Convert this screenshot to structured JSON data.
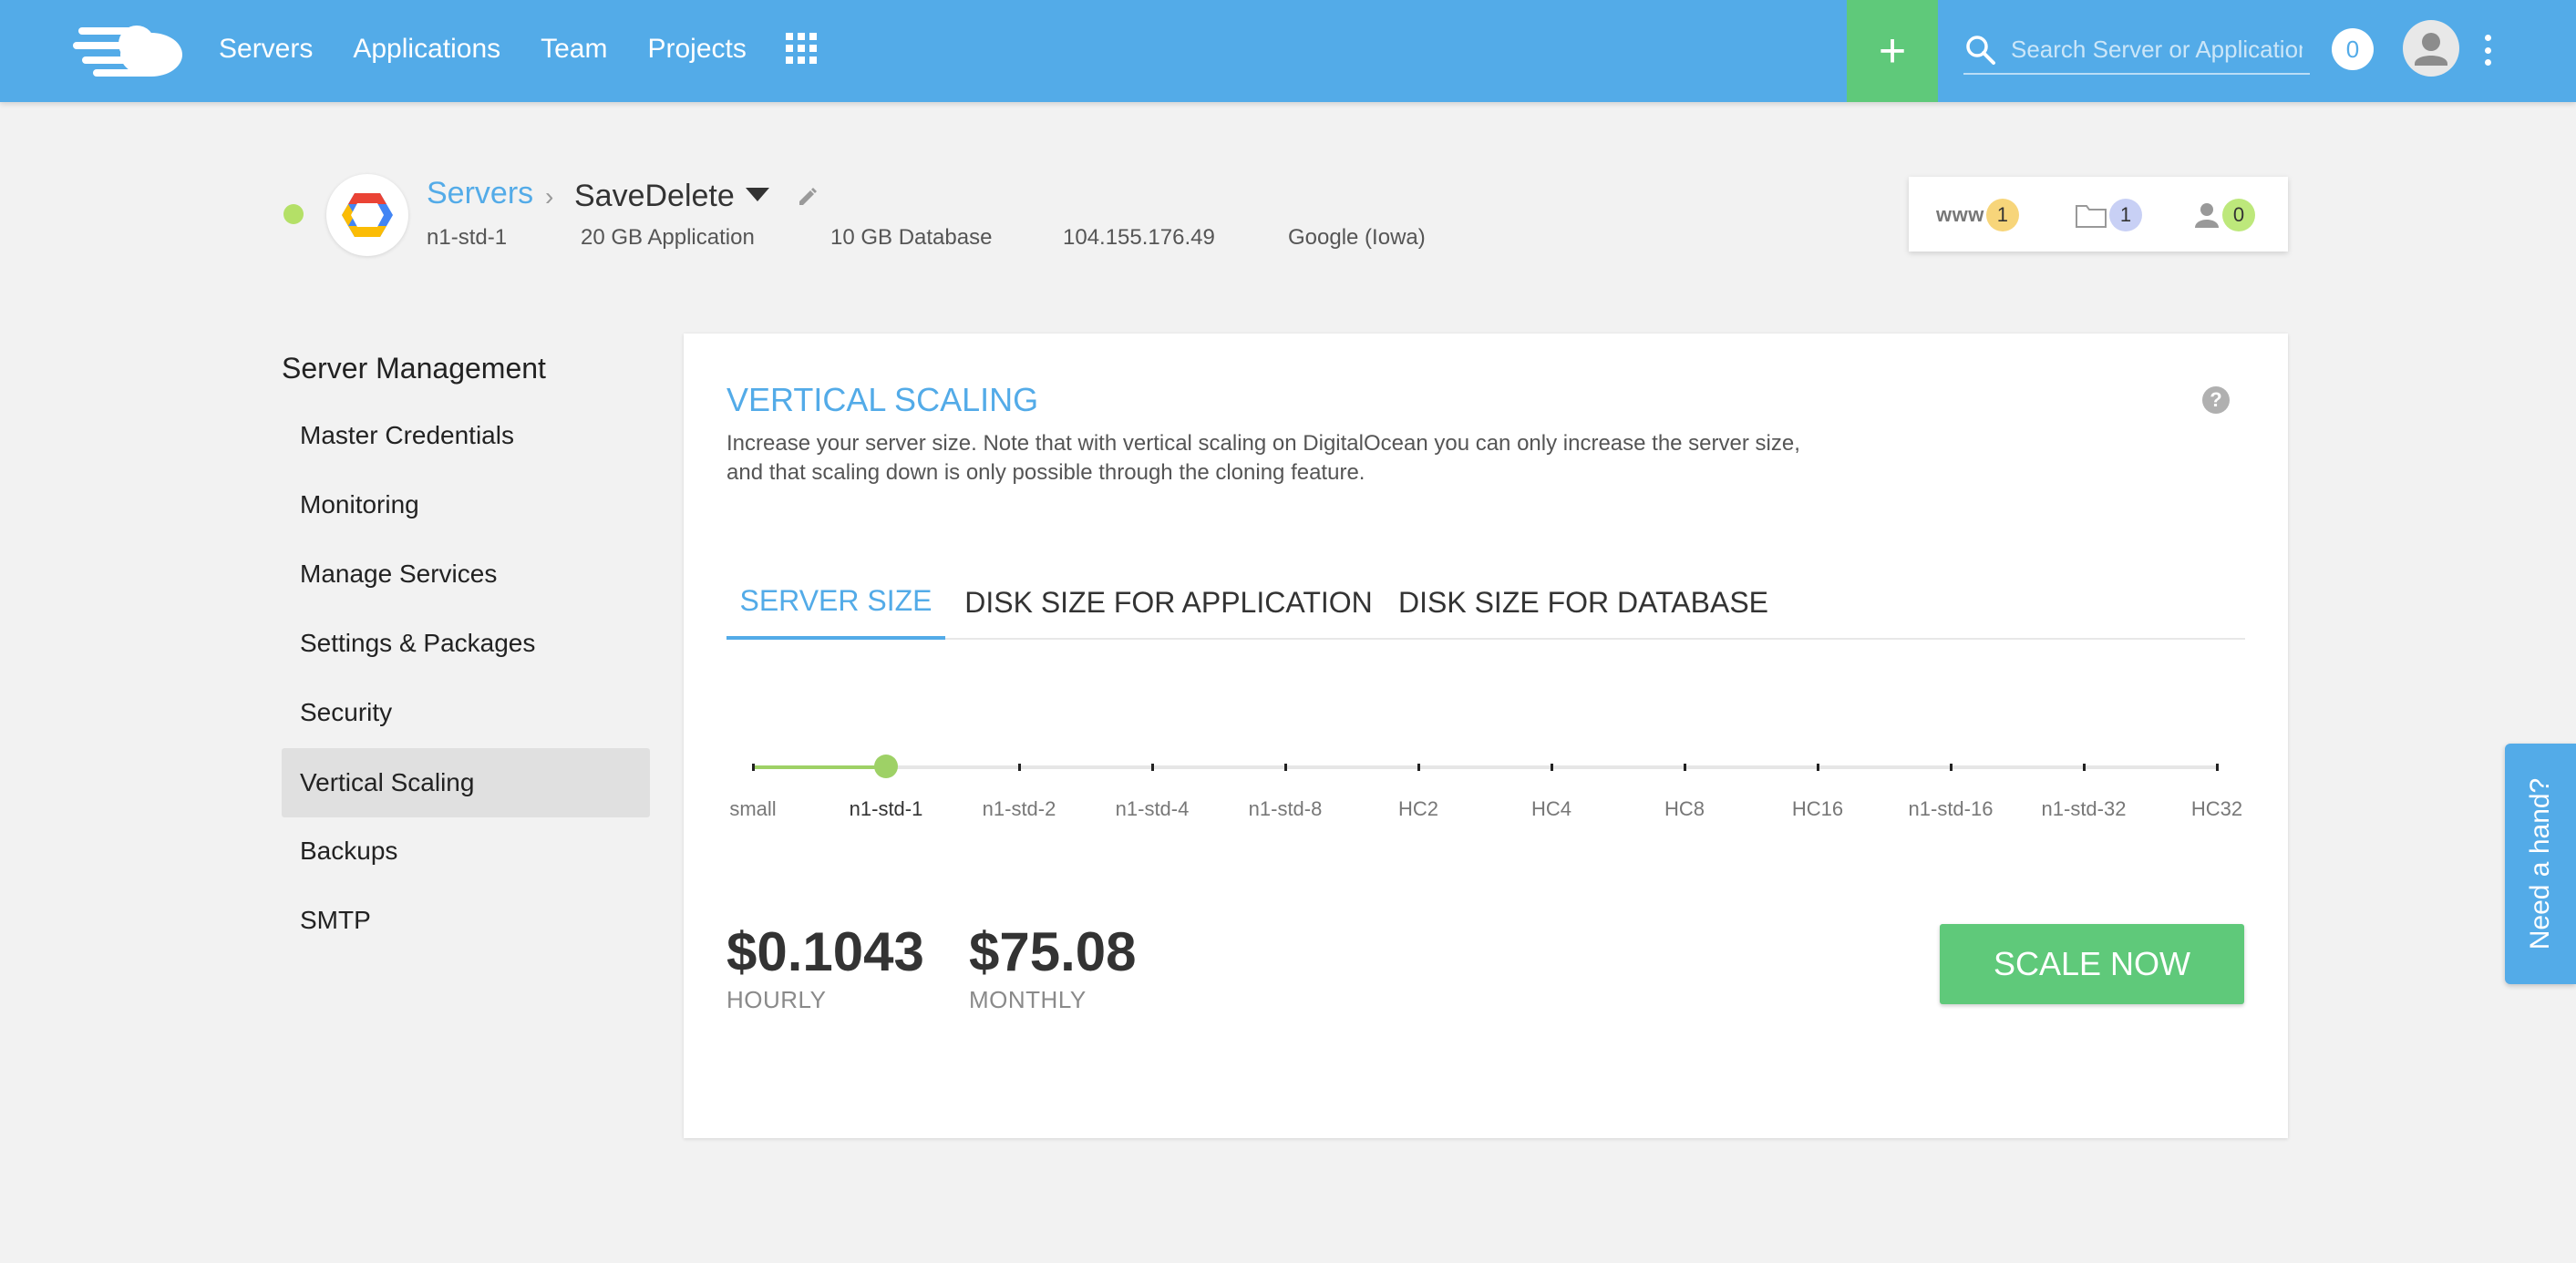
{
  "topbar": {
    "nav": [
      "Servers",
      "Applications",
      "Team",
      "Projects"
    ],
    "add_label": "+",
    "search_placeholder": "Search Server or Application",
    "notification_count": "0"
  },
  "server": {
    "breadcrumb_root": "Servers",
    "breadcrumb_sep": "›",
    "name": "SaveDelete",
    "status_color": "#b4e067",
    "meta": {
      "size": "n1-std-1",
      "app_disk": "20 GB Application",
      "db_disk": "10 GB Database",
      "ip": "104.155.176.49",
      "location": "Google (Iowa)"
    },
    "counts": {
      "www_label": "www",
      "apps": "1",
      "folders": "1",
      "users": "0"
    }
  },
  "sidebar": {
    "title": "Server Management",
    "items": [
      {
        "label": "Master Credentials",
        "active": false
      },
      {
        "label": "Monitoring",
        "active": false
      },
      {
        "label": "Manage Services",
        "active": false
      },
      {
        "label": "Settings & Packages",
        "active": false
      },
      {
        "label": "Security",
        "active": false
      },
      {
        "label": "Vertical Scaling",
        "active": true
      },
      {
        "label": "Backups",
        "active": false
      },
      {
        "label": "SMTP",
        "active": false
      }
    ]
  },
  "scaling": {
    "title": "VERTICAL SCALING",
    "help": "?",
    "description": "Increase your server size. Note that with vertical scaling on DigitalOcean you can only increase the server size, and that scaling down is only possible through the cloning feature.",
    "tabs": [
      {
        "label": "SERVER SIZE",
        "active": true
      },
      {
        "label": "DISK SIZE FOR APPLICATION",
        "active": false
      },
      {
        "label": "DISK SIZE FOR DATABASE",
        "active": false
      }
    ],
    "sizes": [
      "small",
      "n1-std-1",
      "n1-std-2",
      "n1-std-4",
      "n1-std-8",
      "HC2",
      "HC4",
      "HC8",
      "HC16",
      "n1-std-16",
      "n1-std-32",
      "HC32"
    ],
    "selected_index": 1,
    "hourly_price": "$0.1043",
    "hourly_label": "HOURLY",
    "monthly_price": "$75.08",
    "monthly_label": "MONTHLY",
    "button_label": "SCALE NOW"
  },
  "help_tab": "Need a hand?",
  "colors": {
    "brand_blue": "#53abe8",
    "accent_green": "#5fc97a",
    "slider_green": "#9ed166",
    "badge_yellow": "#f7d57a",
    "badge_lavender": "#c8d0f5",
    "badge_green": "#bde87b"
  }
}
